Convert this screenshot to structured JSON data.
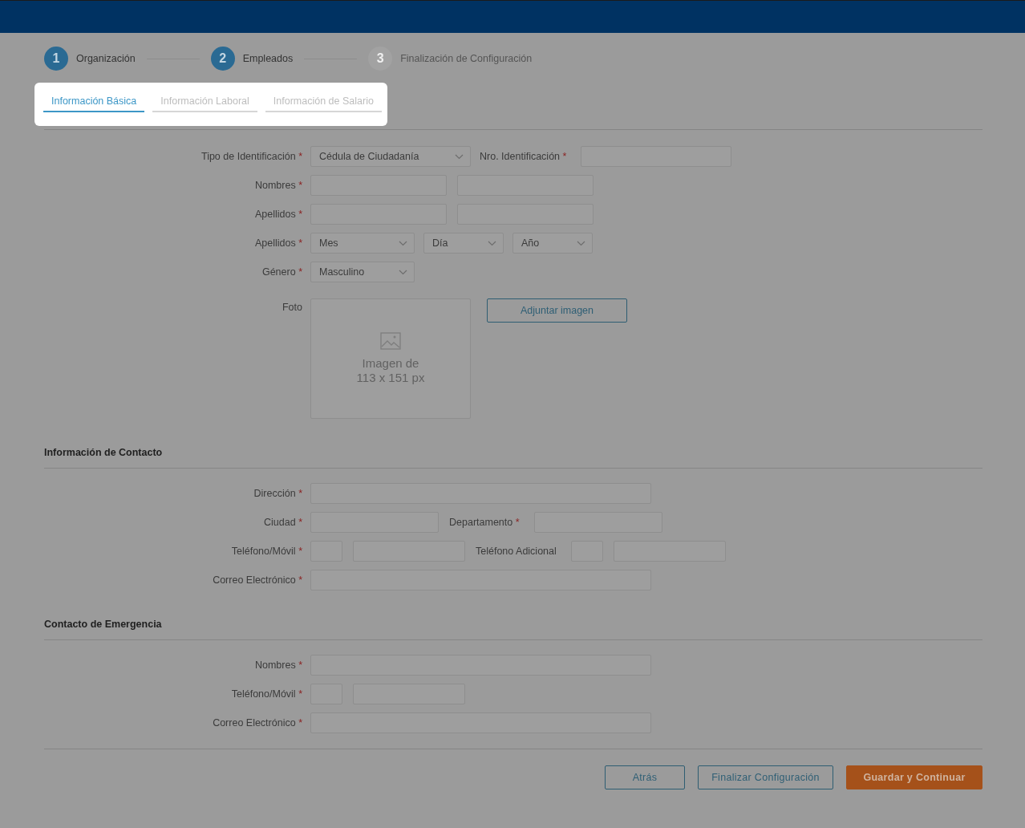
{
  "steps": [
    {
      "number": "1",
      "label": "Organización",
      "reached": true
    },
    {
      "number": "2",
      "label": "Empleados",
      "reached": true
    },
    {
      "number": "3",
      "label": "Finalización de Configuración",
      "reached": false
    }
  ],
  "tabs": [
    {
      "label": "Información Básica",
      "selected": true
    },
    {
      "label": "Información Laboral",
      "selected": false
    },
    {
      "label": "Información de Salario",
      "selected": false
    }
  ],
  "sections": [
    {
      "rows": [
        {
          "label": "Tipo de Identificación",
          "mark": "*",
          "fields": [
            {
              "kind": "select",
              "value": "Cédula de Ciudadanía"
            },
            {
              "kind": "label",
              "text": "Nro. Identificación",
              "mark": "*"
            },
            {
              "kind": "text"
            }
          ]
        },
        {
          "label": "Nombres",
          "mark": "*",
          "fields": [
            {
              "kind": "text"
            },
            {
              "kind": "text"
            }
          ]
        },
        {
          "label": "Apellidos",
          "mark": "*",
          "fields": [
            {
              "kind": "text"
            },
            {
              "kind": "text"
            }
          ]
        },
        {
          "label": "Apellidos",
          "mark": "*",
          "fields": [
            {
              "kind": "select",
              "value": "Mes"
            },
            {
              "kind": "select",
              "value": "Día"
            },
            {
              "kind": "select",
              "value": "Año"
            }
          ]
        },
        {
          "label": "Género",
          "mark": "*",
          "fields": [
            {
              "kind": "select",
              "value": "Masculino"
            }
          ]
        },
        {
          "label": "Foto",
          "fields": [
            {
              "kind": "photo",
              "lines": [
                "Imagen de",
                "113 x 151 px"
              ]
            },
            {
              "kind": "button",
              "text": "Adjuntar imagen"
            }
          ]
        }
      ]
    },
    {
      "title": "Información de Contacto",
      "rows": [
        {
          "label": "Dirección",
          "mark": "*",
          "fields": [
            {
              "kind": "text"
            }
          ]
        },
        {
          "label": "Ciudad",
          "mark": "*",
          "fields": [
            {
              "kind": "text"
            },
            {
              "kind": "label",
              "text": "Departamento",
              "mark": "*"
            },
            {
              "kind": "text"
            }
          ]
        },
        {
          "label": "Teléfono/Móvil",
          "mark": "*",
          "fields": [
            {
              "kind": "text"
            },
            {
              "kind": "text"
            },
            {
              "kind": "label",
              "text": "Teléfono Adicional"
            },
            {
              "kind": "text"
            },
            {
              "kind": "text"
            }
          ]
        },
        {
          "label": "Correo Electrónico",
          "mark": "*",
          "fields": [
            {
              "kind": "text"
            }
          ]
        }
      ]
    },
    {
      "title": "Contacto de Emergencia",
      "rows": [
        {
          "label": "Nombres",
          "mark": "*",
          "fields": [
            {
              "kind": "text"
            }
          ]
        },
        {
          "label": "Teléfono/Móvil",
          "mark": "*",
          "fields": [
            {
              "kind": "text"
            },
            {
              "kind": "text"
            }
          ]
        },
        {
          "label": "Correo Electrónico",
          "mark": "*",
          "fields": [
            {
              "kind": "text"
            }
          ]
        }
      ]
    }
  ],
  "buttons": [
    {
      "label": "Atrás",
      "kind": "outline"
    },
    {
      "label": "Finalizar Configuración",
      "kind": "outline"
    },
    {
      "label": "Guardar y Continuar",
      "kind": "primary"
    }
  ]
}
